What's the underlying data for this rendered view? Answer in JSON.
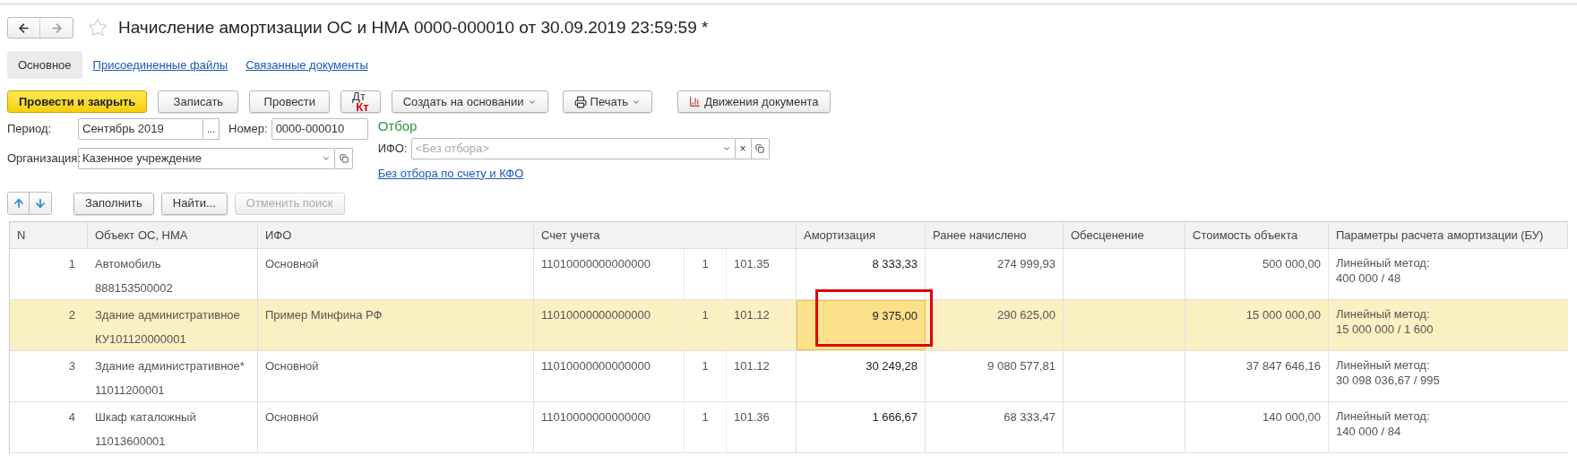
{
  "title": "Начисление амортизации ОС и НМА 0000-000010 от 30.09.2019 23:59:59 *",
  "favorite": false,
  "tabs": [
    {
      "label": "Основное",
      "selected": true
    },
    {
      "label": "Присоединенные файлы",
      "selected": false
    },
    {
      "label": "Связанные документы",
      "selected": false
    }
  ],
  "toolbar": [
    {
      "kind": "primary",
      "label": "Провести и закрыть"
    },
    {
      "kind": "plain",
      "label": "Записать"
    },
    {
      "kind": "plain",
      "label": "Провести"
    },
    {
      "kind": "dtkt",
      "label": "Дт",
      "label2": "Кт"
    },
    {
      "kind": "menu",
      "label": "Создать на основании"
    },
    {
      "kind": "print",
      "label": "Печать"
    },
    {
      "kind": "movements",
      "label": "Движения документа"
    }
  ],
  "period": {
    "label": "Период:",
    "value": "Сентябрь 2019",
    "button": "..."
  },
  "number": {
    "label": "Номер:",
    "value": "0000-000010"
  },
  "organization": {
    "label": "Организация:",
    "value": "Казенное учреждение"
  },
  "filter": {
    "title": "Отбор",
    "ifo_label": "ИФО:",
    "ifo_placeholder": "<Без отбора>",
    "clear": "×",
    "link": "Без отбора по счету и КФО"
  },
  "table_toolbar": [
    {
      "kind": "up"
    },
    {
      "kind": "down"
    },
    {
      "kind": "button",
      "label": "Заполнить",
      "disabled": false
    },
    {
      "kind": "button",
      "label": "Найти...",
      "disabled": false
    },
    {
      "kind": "button",
      "label": "Отменить поиск",
      "disabled": true
    }
  ],
  "table": {
    "columns": [
      "N",
      "Объект ОС, НМА",
      "ИФО",
      "Счет учета",
      "Амортизация",
      "Ранее начислено",
      "Обесценение",
      "Стоимость объекта",
      "Параметры расчета амортизации (БУ)"
    ],
    "rows": [
      {
        "n": "1",
        "object": "Автомобиль",
        "inventory": "888153500002",
        "ifo": "Основной",
        "account": "11010000000000000",
        "kfo": "1",
        "subaccount": "101.35",
        "amortization": "8 333,33",
        "previous": "274 999,93",
        "value": "500 000,00",
        "params_1": "Линейный метод:",
        "params_2": "400 000 / 48",
        "selected": false,
        "outlined": false
      },
      {
        "n": "2",
        "object": "Здание административное",
        "inventory": "КУ101120000001",
        "ifo": "Пример Минфина РФ",
        "account": "11010000000000000",
        "kfo": "1",
        "subaccount": "101.12",
        "amortization": "9 375,00",
        "previous": "290 625,00",
        "value": "15 000 000,00",
        "params_1": "Линейный метод:",
        "params_2": "15 000 000 / 1 600",
        "selected": true,
        "outlined": true
      },
      {
        "n": "3",
        "object": "Здание административное*",
        "inventory": "11011200001",
        "ifo": "Основной",
        "account": "11010000000000000",
        "kfo": "1",
        "subaccount": "101.12",
        "amortization": "30 249,28",
        "previous": "9 080 577,81",
        "value": "37 847 646,16",
        "params_1": "Линейный метод:",
        "params_2": "30 098 036,67 / 995",
        "selected": false,
        "outlined": false
      },
      {
        "n": "4",
        "object": "Шкаф каталожный",
        "inventory": "11013600001",
        "ifo": "Основной",
        "account": "11010000000000000",
        "kfo": "1",
        "subaccount": "101.36",
        "amortization": "1 666,67",
        "previous": "68 333,47",
        "value": "140 000,00",
        "params_1": "Линейный метод:",
        "params_2": "140 000 / 84",
        "selected": false,
        "outlined": false
      }
    ]
  }
}
